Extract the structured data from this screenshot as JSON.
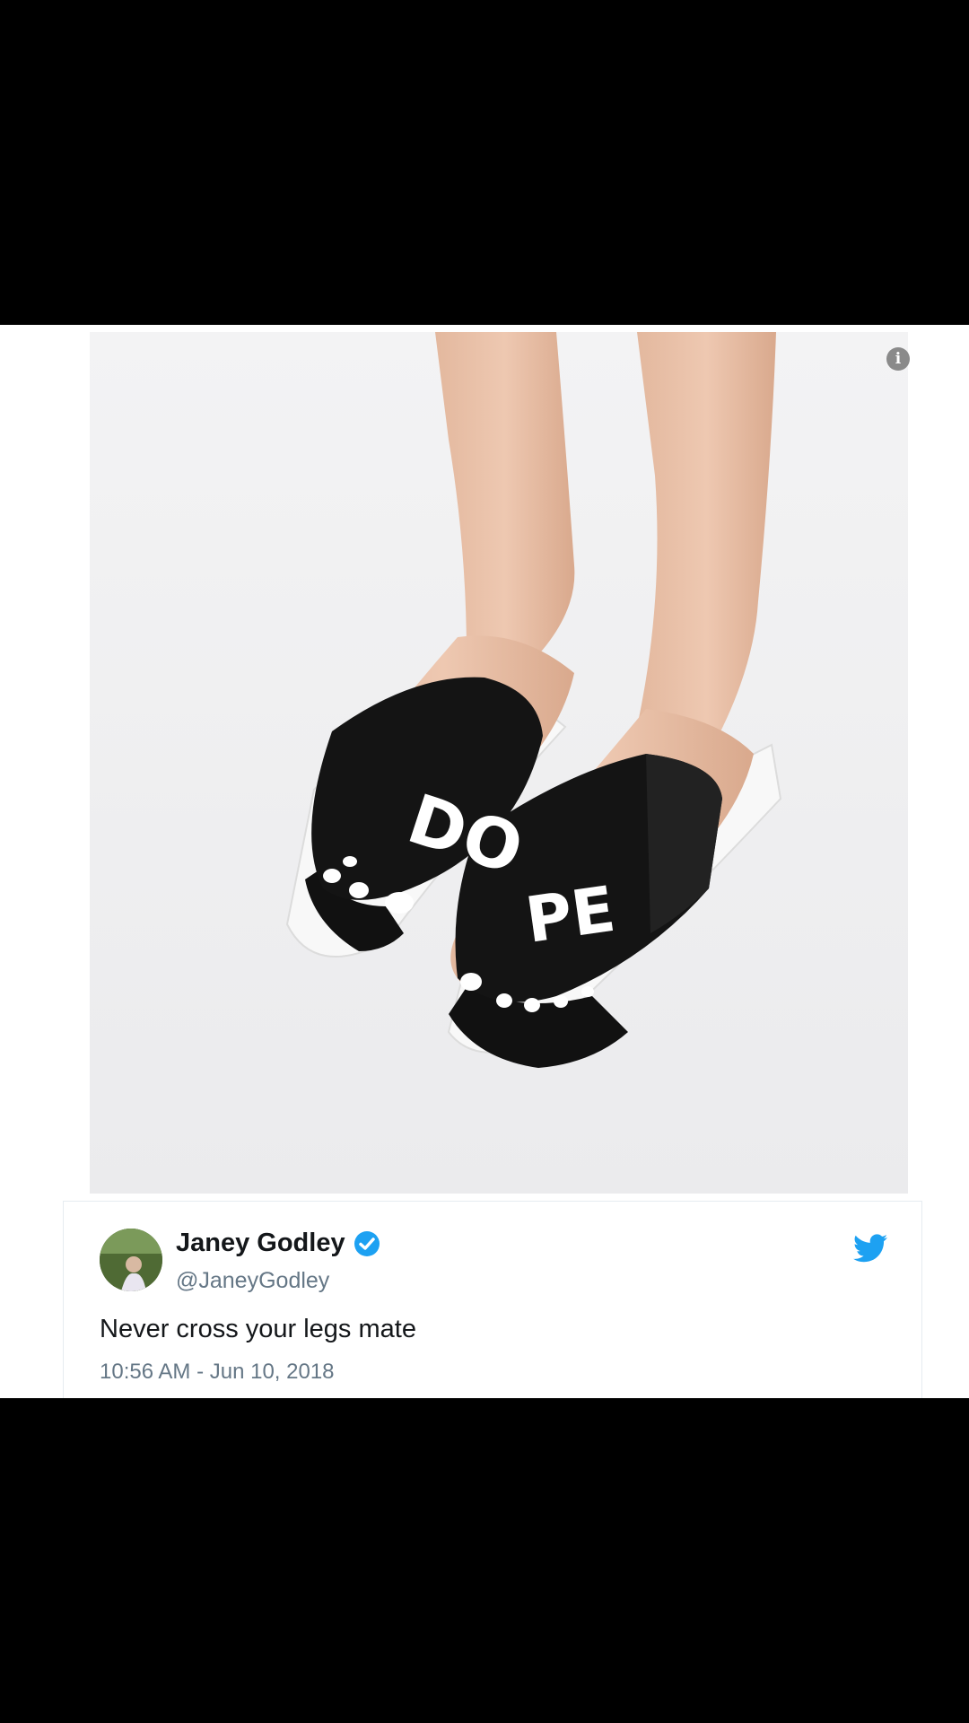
{
  "tweet": {
    "display_name": "Janey Godley",
    "handle": "@JaneyGodley",
    "text": "Never cross your legs mate",
    "timestamp": "10:56 AM - Jun 10, 2018",
    "verified": true
  },
  "photo": {
    "left_strap_text": "DO",
    "right_strap_text": "PE"
  },
  "icons": {
    "info": "info-icon",
    "verified": "verified-badge-icon",
    "brand": "twitter-bird-icon"
  },
  "colors": {
    "verified_blue": "#1da1f2",
    "twitter_blue": "#1da1f2",
    "name_text": "#14171a",
    "secondary_text": "#657786"
  }
}
